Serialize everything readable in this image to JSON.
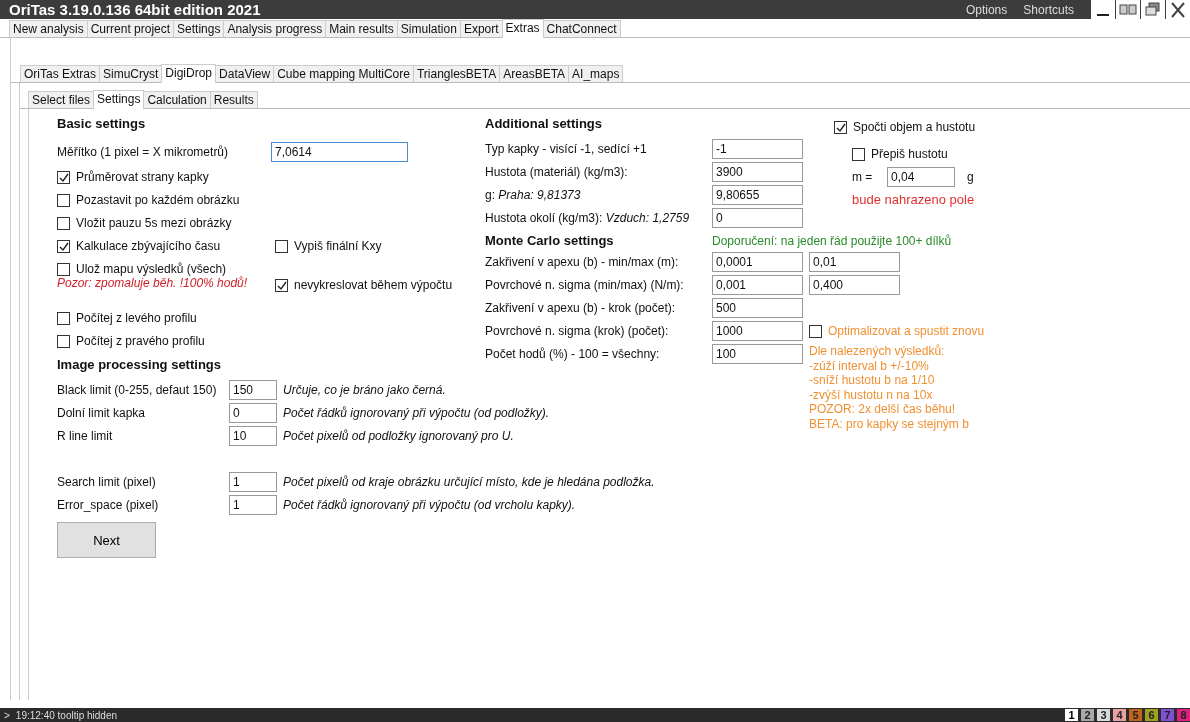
{
  "window": {
    "title": "OriTas 3.19.0.136 64bit edition 2021",
    "menu": [
      "Options",
      "Shortcuts"
    ]
  },
  "main_tabs": [
    {
      "label": "New analysis",
      "selected": false
    },
    {
      "label": "Current project",
      "selected": false
    },
    {
      "label": "Settings",
      "selected": false
    },
    {
      "label": "Analysis progress",
      "selected": false
    },
    {
      "label": "Main results",
      "selected": false
    },
    {
      "label": "Simulation",
      "selected": false
    },
    {
      "label": "Export",
      "selected": false
    },
    {
      "label": "Extras",
      "selected": true
    },
    {
      "label": "ChatConnect",
      "selected": false
    }
  ],
  "sub_tabs": [
    {
      "label": "OriTas Extras",
      "selected": false
    },
    {
      "label": "SimuCryst",
      "selected": false
    },
    {
      "label": "DigiDrop",
      "selected": true
    },
    {
      "label": "DataView",
      "selected": false
    },
    {
      "label": "Cube mapping MultiCore",
      "selected": false
    },
    {
      "label": "TrianglesBETA",
      "selected": false
    },
    {
      "label": "AreasBETA",
      "selected": false
    },
    {
      "label": "AI_maps",
      "selected": false
    }
  ],
  "inner_tabs": [
    {
      "label": "Select files",
      "selected": false
    },
    {
      "label": "Settings",
      "selected": true
    },
    {
      "label": "Calculation",
      "selected": false
    },
    {
      "label": "Results",
      "selected": false
    }
  ],
  "basic_settings": {
    "title": "Basic settings",
    "scale_label": "Měřítko (1 pixel = X mikrometrů)",
    "scale_value": "7,0614",
    "rows": [
      {
        "items": [
          {
            "label": "Průměrovat strany kapky",
            "checked": true
          }
        ]
      },
      {
        "items": [
          {
            "label": "Pozastavit po každém obrázku",
            "checked": false
          }
        ]
      },
      {
        "items": [
          {
            "label": "Vložit pauzu 5s mezi obrázky",
            "checked": false
          }
        ]
      },
      {
        "items": [
          {
            "label": "Kalkulace zbývajícího času",
            "checked": true
          },
          {
            "label": "Vypiš finální Kxy",
            "checked": false
          }
        ]
      },
      {
        "items": [
          {
            "label": "Ulož mapu výsledků (všech)",
            "checked": false,
            "warning": "Pozor: zpomaluje běh. !100% hodů!"
          },
          {
            "label": "nevykreslovat během výpočtu",
            "checked": true
          }
        ]
      },
      {
        "items": [
          {
            "label": "Počítej z levého profilu",
            "checked": false
          }
        ]
      },
      {
        "items": [
          {
            "label": "Počítej z pravého profilu",
            "checked": false
          }
        ]
      }
    ]
  },
  "image_processing": {
    "title": "Image processing settings",
    "rows": [
      {
        "label": "Black limit (0-255, defaut 150)",
        "value": "150",
        "hint": "Určuje, co je bráno jako černá."
      },
      {
        "label": "Dolní limit kapka",
        "value": "0",
        "hint": "Počet řádků ignorovaný při výpočtu (od podložky)."
      },
      {
        "label": "R line limit",
        "value": "10",
        "hint": "Počet pixelů od podložky ignorovaný pro U."
      }
    ],
    "extra_rows": [
      {
        "label": "Search limit (pixel)",
        "value": "1",
        "hint": "Počet pixelů od kraje obrázku určující místo, kde je hledána podložka."
      },
      {
        "label": "Error_space (pixel)",
        "value": "1",
        "hint": "Počet řádků ignorovaný při výpočtu (od vrcholu kapky)."
      }
    ],
    "next_button": "Next"
  },
  "additional_settings": {
    "title": "Additional settings",
    "rows": [
      {
        "label": "Typ kapky - visící -1, sedící +1",
        "value": "-1"
      },
      {
        "label": "Hustota (materiál) (kg/m3):",
        "value": "3900"
      },
      {
        "label": "g: *Praha: 9,81373*",
        "value": "9,80655"
      },
      {
        "label": "Hustota okolí (kg/m3): *Vzduch: 1,2759*",
        "value": "0"
      }
    ],
    "compute_volume": {
      "label": "Spočti objem a hustotu",
      "checked": true
    },
    "overwrite_density": {
      "label": "Přepiš hustotu",
      "checked": false
    },
    "mass": {
      "label": "m =",
      "value": "0,04",
      "unit": "g"
    },
    "warning": "bude nahrazeno pole"
  },
  "monte_carlo": {
    "title": "Monte Carlo settings",
    "recommendation": "Doporučení: na jeden řád použijte 100+ dílků",
    "rows": [
      {
        "label": "Zakřivení v apexu (b) - min/max (m):",
        "values": [
          "0,0001",
          "0,01"
        ]
      },
      {
        "label": "Povrchové n. sigma (min/max) (N/m):",
        "values": [
          "0,001",
          "0,400"
        ]
      },
      {
        "label": "Zakřivení v apexu (b) - krok (počet):",
        "values": [
          "500"
        ]
      },
      {
        "label": "Povrchové n. sigma (krok) (počet):",
        "values": [
          "1000"
        ]
      },
      {
        "label": "Počet hodů (%) - 100 = všechny:",
        "values": [
          "100"
        ]
      }
    ],
    "optimize": {
      "label": "Optimalizovat a spustit znovu",
      "checked": false
    },
    "notes": [
      "Dle nalezených výsledků:",
      "-zúží interval b +/-10%",
      "-sníží hustotu b na 1/10",
      "-zvýší hustotu n na 10x",
      "POZOR: 2x delší čas běhu!",
      "BETA: pro kapky se stejným b"
    ]
  },
  "status_bar": {
    "prompt": ">",
    "message": "19:12:40 tooltip hidden",
    "slots": [
      {
        "label": "1",
        "color": "#ffffff"
      },
      {
        "label": "2",
        "color": "#a8a8a8"
      },
      {
        "label": "3",
        "color": "#d8d8d8"
      },
      {
        "label": "4",
        "color": "#e8a0a0"
      },
      {
        "label": "5",
        "color": "#c0641e"
      },
      {
        "label": "6",
        "color": "#a0a020"
      },
      {
        "label": "7",
        "color": "#8050d0"
      },
      {
        "label": "8",
        "color": "#e02080"
      }
    ]
  }
}
